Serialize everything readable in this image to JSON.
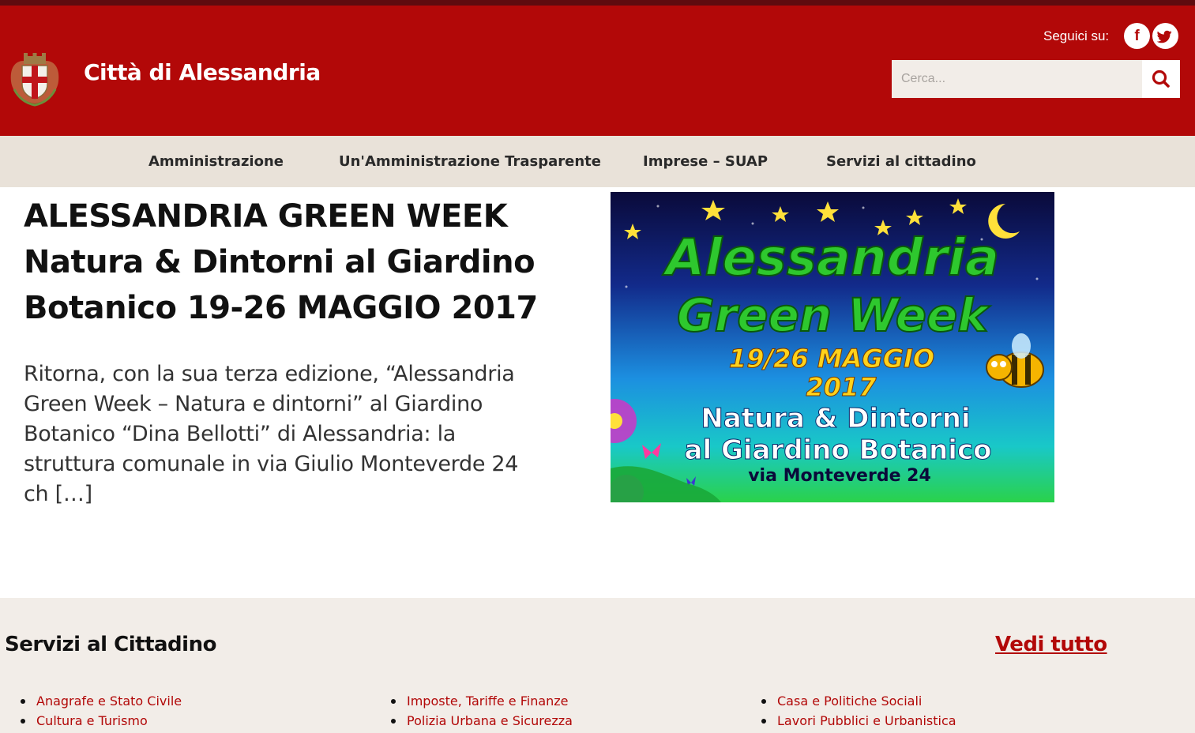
{
  "header": {
    "site_title": "Città di Alessandria",
    "follow_label": "Seguici su:",
    "social": [
      {
        "name": "facebook-icon",
        "glyph": "f"
      },
      {
        "name": "twitter-icon",
        "glyph": "t"
      }
    ],
    "search": {
      "placeholder": "Cerca..."
    },
    "colors": {
      "brand": "#b20808",
      "topstrip": "#5e0b0f",
      "nav_bg": "#e9e2d9",
      "services_bg": "#f2ede8"
    }
  },
  "nav": {
    "items": [
      {
        "label": "Amministrazione"
      },
      {
        "label": "Un'Amministrazione Trasparente"
      },
      {
        "label": "Imprese – SUAP"
      },
      {
        "label": "Servizi al cittadino"
      }
    ]
  },
  "article": {
    "title": "ALESSANDRIA GREEN WEEK Natura & Dintorni al Giardino Botanico 19-26 MAGGIO 2017",
    "excerpt": "Ritorna, con la sua terza edizione, “Alessandria Green Week – Natura e dintorni” al Giardino Botanico “Dina Bellotti” di Alessandria: la struttura comunale in via Giulio Monteverde 24 ch […]",
    "banner": {
      "line1": "Alessandria",
      "line2": "Green Week",
      "line3": "19/26 MAGGIO",
      "line4": "2017",
      "line5": "Natura & Dintorni",
      "line6": "al Giardino Botanico",
      "line7": "via Monteverde 24"
    }
  },
  "services": {
    "title": "Servizi al Cittadino",
    "see_all": "Vedi tutto",
    "columns": [
      [
        "Anagrafe e Stato Civile",
        "Cultura e Turismo"
      ],
      [
        "Imposte, Tariffe e Finanze",
        "Polizia Urbana e Sicurezza"
      ],
      [
        "Casa e Politiche Sociali",
        "Lavori Pubblici e Urbanistica"
      ]
    ]
  }
}
